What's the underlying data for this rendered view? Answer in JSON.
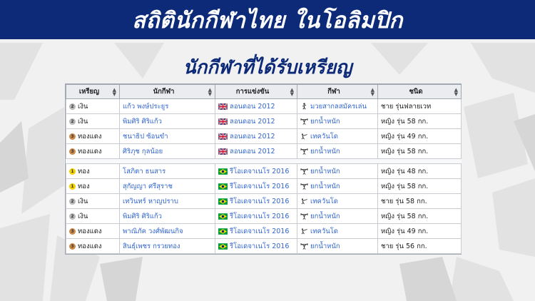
{
  "banner": {
    "title": "สถิตินักกีฬาไทย ในโอลิมปิก"
  },
  "subtitle": "นักกีฬาที่ได้รับเหรียญ",
  "table": {
    "headers": [
      "เหรียญ",
      "นักกีฬา",
      "การแข่งขัน",
      "กีฬา",
      "ชนิด"
    ],
    "groups": [
      [
        {
          "medal_type": "silver",
          "medal_num": "2",
          "medal": "เงิน",
          "athlete": "แก้ว พงษ์ประยูร",
          "flag": "gb",
          "games": "ลอนดอน 2012",
          "sport_icon": "boxing-icon",
          "sport": "มวยสากลสมัครเล่น",
          "event": "ชาย รุ่นฟลายเวท"
        },
        {
          "medal_type": "silver",
          "medal_num": "2",
          "medal": "เงิน",
          "athlete": "พิมศิริ ศิริแก้ว",
          "flag": "gb",
          "games": "ลอนดอน 2012",
          "sport_icon": "weightlifting-icon",
          "sport": "ยกน้ำหนัก",
          "event": "หญิง รุ่น 58 กก."
        },
        {
          "medal_type": "bronze",
          "medal_num": "3",
          "medal": "ทองแดง",
          "athlete": "ชนาธิป ซ้อนขำ",
          "flag": "gb",
          "games": "ลอนดอน 2012",
          "sport_icon": "taekwondo-icon",
          "sport": "เทควันโด",
          "event": "หญิง รุ่น 49 กก."
        },
        {
          "medal_type": "bronze",
          "medal_num": "3",
          "medal": "ทองแดง",
          "athlete": "ศิริภุช กุลน้อย",
          "flag": "gb",
          "games": "ลอนดอน 2012",
          "sport_icon": "weightlifting-icon",
          "sport": "ยกน้ำหนัก",
          "event": "หญิง รุ่น 58 กก."
        }
      ],
      [
        {
          "medal_type": "gold",
          "medal_num": "1",
          "medal": "ทอง",
          "athlete": "โสภิตา ธนสาร",
          "flag": "br",
          "games": "รีโอเดจาเนโร 2016",
          "sport_icon": "weightlifting-icon",
          "sport": "ยกน้ำหนัก",
          "event": "หญิง รุ่น 48 กก."
        },
        {
          "medal_type": "gold",
          "medal_num": "1",
          "medal": "ทอง",
          "athlete": "สุกัญญา ศรีสุราช",
          "flag": "br",
          "games": "รีโอเดจาเนโร 2016",
          "sport_icon": "weightlifting-icon",
          "sport": "ยกน้ำหนัก",
          "event": "หญิง รุ่น 58 กก."
        },
        {
          "medal_type": "silver",
          "medal_num": "2",
          "medal": "เงิน",
          "athlete": "เทวินทร์ หาญปราบ",
          "flag": "br",
          "games": "รีโอเดจาเนโร 2016",
          "sport_icon": "taekwondo-icon",
          "sport": "เทควันโด",
          "event": "ชาย รุ่น 58 กก."
        },
        {
          "medal_type": "silver",
          "medal_num": "2",
          "medal": "เงิน",
          "athlete": "พิมศิริ ศิริแก้ว",
          "flag": "br",
          "games": "รีโอเดจาเนโร 2016",
          "sport_icon": "weightlifting-icon",
          "sport": "ยกน้ำหนัก",
          "event": "หญิง รุ่น 58 กก."
        },
        {
          "medal_type": "bronze",
          "medal_num": "3",
          "medal": "ทองแดง",
          "athlete": "พาณิภัค วงศ์พัฒนกิจ",
          "flag": "br",
          "games": "รีโอเดจาเนโร 2016",
          "sport_icon": "taekwondo-icon",
          "sport": "เทควันโด",
          "event": "หญิง รุ่น 49 กก."
        },
        {
          "medal_type": "bronze",
          "medal_num": "3",
          "medal": "ทองแดง",
          "athlete": "สินธุ์เพชร กรวยทอง",
          "flag": "br",
          "games": "รีโอเดจาเนโร 2016",
          "sport_icon": "weightlifting-icon",
          "sport": "ยกน้ำหนัก",
          "event": "ชาย รุ่น 56 กก."
        }
      ]
    ]
  },
  "colors": {
    "banner": "#0c2a78",
    "subtitle": "#0c2a78",
    "link": "#3366cc",
    "gold": "#f1d100",
    "silver": "#b8b8b8",
    "bronze": "#c98a4a"
  }
}
